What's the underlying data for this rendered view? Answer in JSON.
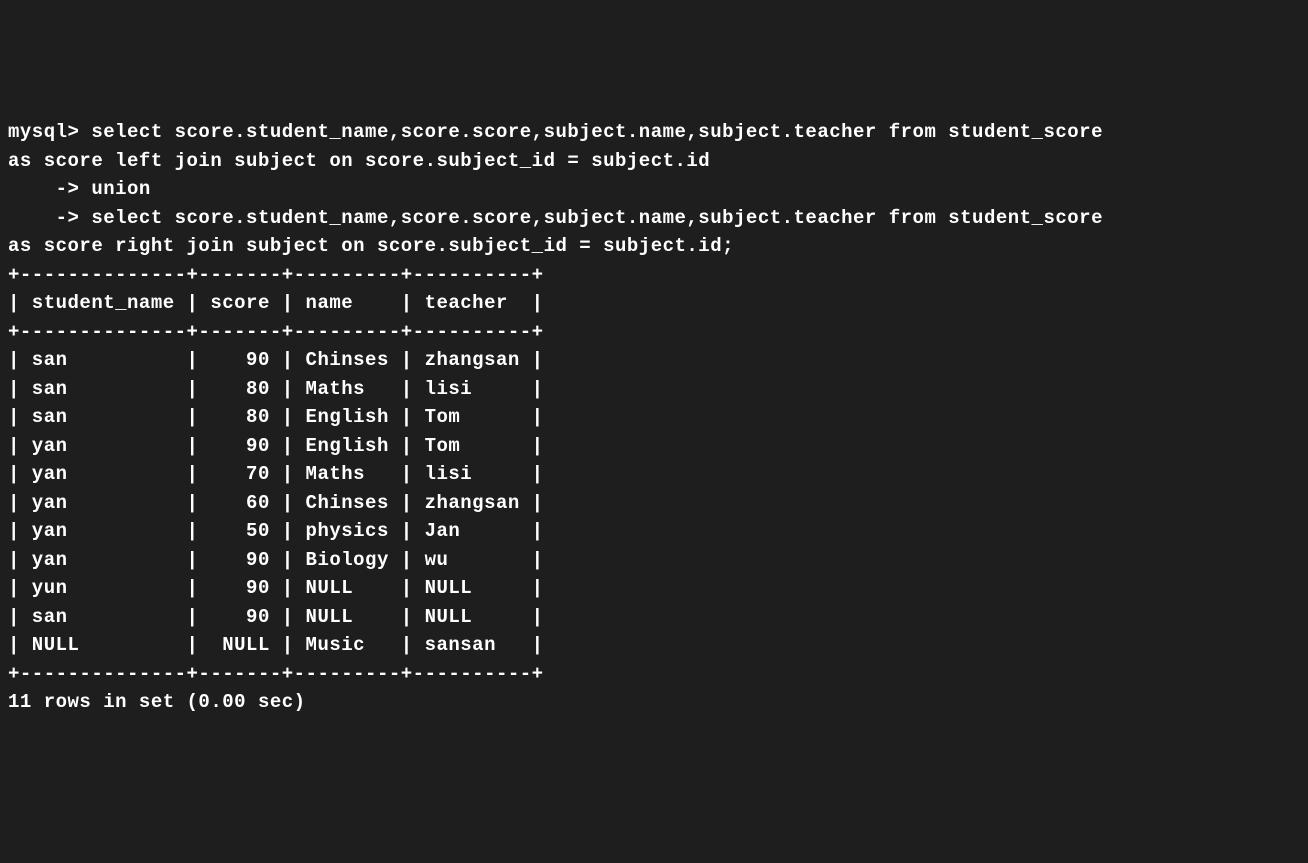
{
  "prompt": "mysql>",
  "continuation": "    ->",
  "query_lines": [
    "mysql> select score.student_name,score.score,subject.name,subject.teacher from student_score",
    "as score left join subject on score.subject_id = subject.id",
    "    -> union",
    "    -> select score.student_name,score.score,subject.name,subject.teacher from student_score",
    "as score right join subject on score.subject_id = subject.id;"
  ],
  "table": {
    "border_top": "+--------------+-------+---------+----------+",
    "header": "| student_name | score | name    | teacher  |",
    "border_mid": "+--------------+-------+---------+----------+",
    "columns": [
      "student_name",
      "score",
      "name",
      "teacher"
    ],
    "rows": [
      {
        "student_name": "san",
        "score": "90",
        "name": "Chinses",
        "teacher": "zhangsan"
      },
      {
        "student_name": "san",
        "score": "80",
        "name": "Maths",
        "teacher": "lisi"
      },
      {
        "student_name": "san",
        "score": "80",
        "name": "English",
        "teacher": "Tom"
      },
      {
        "student_name": "yan",
        "score": "90",
        "name": "English",
        "teacher": "Tom"
      },
      {
        "student_name": "yan",
        "score": "70",
        "name": "Maths",
        "teacher": "lisi"
      },
      {
        "student_name": "yan",
        "score": "60",
        "name": "Chinses",
        "teacher": "zhangsan"
      },
      {
        "student_name": "yan",
        "score": "50",
        "name": "physics",
        "teacher": "Jan"
      },
      {
        "student_name": "yan",
        "score": "90",
        "name": "Biology",
        "teacher": "wu"
      },
      {
        "student_name": "yun",
        "score": "90",
        "name": "NULL",
        "teacher": "NULL"
      },
      {
        "student_name": "san",
        "score": "90",
        "name": "NULL",
        "teacher": "NULL"
      },
      {
        "student_name": "NULL",
        "score": "NULL",
        "name": "Music",
        "teacher": "sansan"
      }
    ],
    "border_bot": "+--------------+-------+---------+----------+"
  },
  "footer": "11 rows in set (0.00 sec)",
  "col_widths": {
    "student_name": 12,
    "score": 5,
    "name": 7,
    "teacher": 8
  }
}
